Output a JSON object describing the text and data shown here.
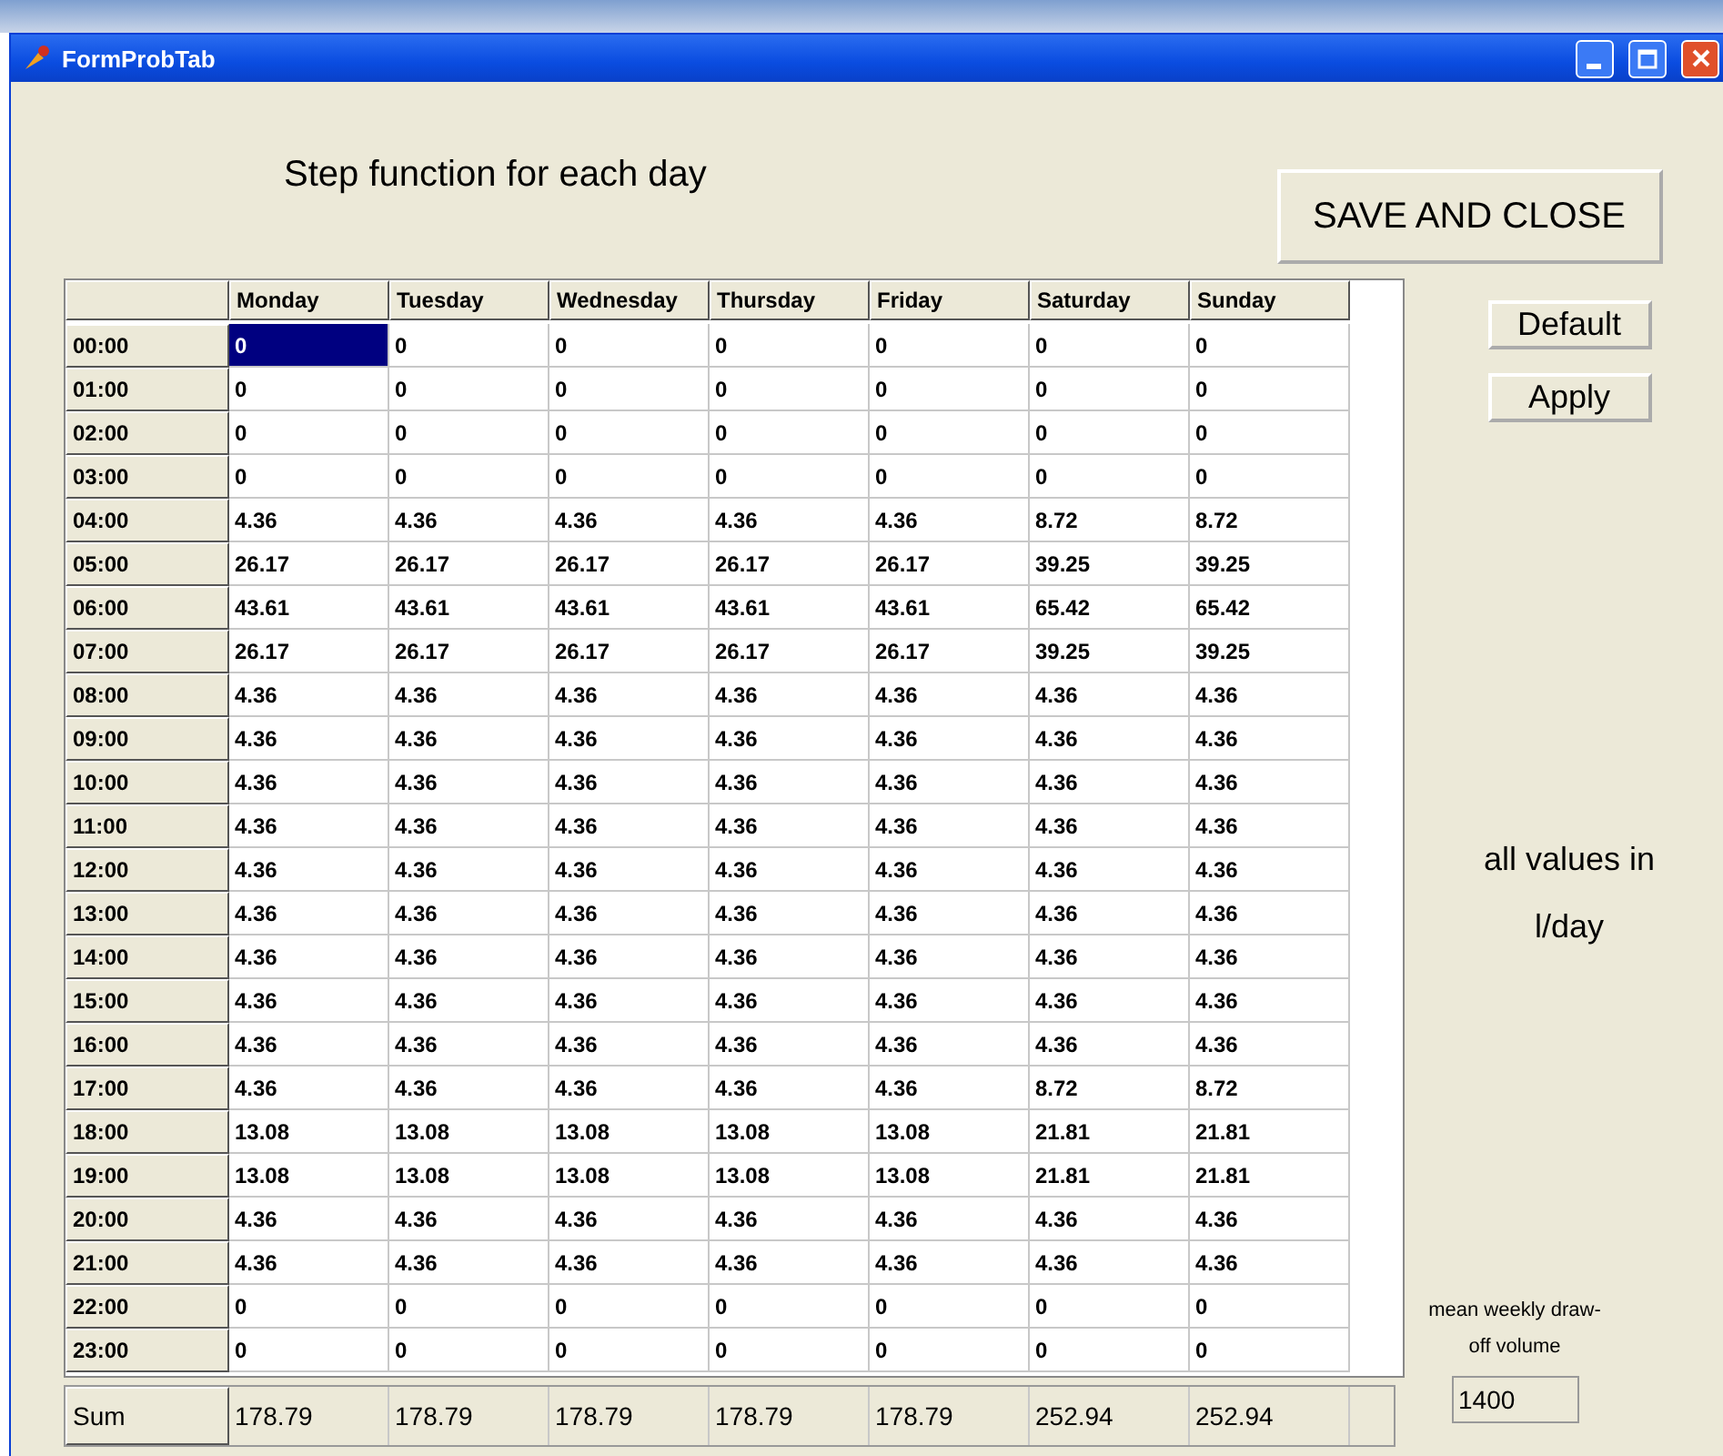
{
  "window": {
    "title": "FormProbTab"
  },
  "heading": "Step function for each day",
  "save_button": "SAVE AND CLOSE",
  "buttons": [
    "Default",
    "Apply"
  ],
  "note": [
    "all values in",
    "l/day"
  ],
  "table": {
    "columns": [
      "Monday",
      "Tuesday",
      "Wednesday",
      "Thursday",
      "Friday",
      "Saturday",
      "Sunday"
    ],
    "rows": [
      {
        "time": "00:00",
        "cells": [
          {
            "v": "0",
            "selected": true
          },
          {
            "v": "0",
            "selected": false
          },
          {
            "v": "0",
            "selected": false
          },
          {
            "v": "0",
            "selected": false
          },
          {
            "v": "0",
            "selected": false
          },
          {
            "v": "0",
            "selected": false
          },
          {
            "v": "0",
            "selected": false
          }
        ]
      },
      {
        "time": "01:00",
        "cells": [
          {
            "v": "0",
            "selected": false
          },
          {
            "v": "0",
            "selected": false
          },
          {
            "v": "0",
            "selected": false
          },
          {
            "v": "0",
            "selected": false
          },
          {
            "v": "0",
            "selected": false
          },
          {
            "v": "0",
            "selected": false
          },
          {
            "v": "0",
            "selected": false
          }
        ]
      },
      {
        "time": "02:00",
        "cells": [
          {
            "v": "0",
            "selected": false
          },
          {
            "v": "0",
            "selected": false
          },
          {
            "v": "0",
            "selected": false
          },
          {
            "v": "0",
            "selected": false
          },
          {
            "v": "0",
            "selected": false
          },
          {
            "v": "0",
            "selected": false
          },
          {
            "v": "0",
            "selected": false
          }
        ]
      },
      {
        "time": "03:00",
        "cells": [
          {
            "v": "0",
            "selected": false
          },
          {
            "v": "0",
            "selected": false
          },
          {
            "v": "0",
            "selected": false
          },
          {
            "v": "0",
            "selected": false
          },
          {
            "v": "0",
            "selected": false
          },
          {
            "v": "0",
            "selected": false
          },
          {
            "v": "0",
            "selected": false
          }
        ]
      },
      {
        "time": "04:00",
        "cells": [
          {
            "v": "4.36",
            "selected": false
          },
          {
            "v": "4.36",
            "selected": false
          },
          {
            "v": "4.36",
            "selected": false
          },
          {
            "v": "4.36",
            "selected": false
          },
          {
            "v": "4.36",
            "selected": false
          },
          {
            "v": "8.72",
            "selected": false
          },
          {
            "v": "8.72",
            "selected": false
          }
        ]
      },
      {
        "time": "05:00",
        "cells": [
          {
            "v": "26.17",
            "selected": false
          },
          {
            "v": "26.17",
            "selected": false
          },
          {
            "v": "26.17",
            "selected": false
          },
          {
            "v": "26.17",
            "selected": false
          },
          {
            "v": "26.17",
            "selected": false
          },
          {
            "v": "39.25",
            "selected": false
          },
          {
            "v": "39.25",
            "selected": false
          }
        ]
      },
      {
        "time": "06:00",
        "cells": [
          {
            "v": "43.61",
            "selected": false
          },
          {
            "v": "43.61",
            "selected": false
          },
          {
            "v": "43.61",
            "selected": false
          },
          {
            "v": "43.61",
            "selected": false
          },
          {
            "v": "43.61",
            "selected": false
          },
          {
            "v": "65.42",
            "selected": false
          },
          {
            "v": "65.42",
            "selected": false
          }
        ]
      },
      {
        "time": "07:00",
        "cells": [
          {
            "v": "26.17",
            "selected": false
          },
          {
            "v": "26.17",
            "selected": false
          },
          {
            "v": "26.17",
            "selected": false
          },
          {
            "v": "26.17",
            "selected": false
          },
          {
            "v": "26.17",
            "selected": false
          },
          {
            "v": "39.25",
            "selected": false
          },
          {
            "v": "39.25",
            "selected": false
          }
        ]
      },
      {
        "time": "08:00",
        "cells": [
          {
            "v": "4.36",
            "selected": false
          },
          {
            "v": "4.36",
            "selected": false
          },
          {
            "v": "4.36",
            "selected": false
          },
          {
            "v": "4.36",
            "selected": false
          },
          {
            "v": "4.36",
            "selected": false
          },
          {
            "v": "4.36",
            "selected": false
          },
          {
            "v": "4.36",
            "selected": false
          }
        ]
      },
      {
        "time": "09:00",
        "cells": [
          {
            "v": "4.36",
            "selected": false
          },
          {
            "v": "4.36",
            "selected": false
          },
          {
            "v": "4.36",
            "selected": false
          },
          {
            "v": "4.36",
            "selected": false
          },
          {
            "v": "4.36",
            "selected": false
          },
          {
            "v": "4.36",
            "selected": false
          },
          {
            "v": "4.36",
            "selected": false
          }
        ]
      },
      {
        "time": "10:00",
        "cells": [
          {
            "v": "4.36",
            "selected": false
          },
          {
            "v": "4.36",
            "selected": false
          },
          {
            "v": "4.36",
            "selected": false
          },
          {
            "v": "4.36",
            "selected": false
          },
          {
            "v": "4.36",
            "selected": false
          },
          {
            "v": "4.36",
            "selected": false
          },
          {
            "v": "4.36",
            "selected": false
          }
        ]
      },
      {
        "time": "11:00",
        "cells": [
          {
            "v": "4.36",
            "selected": false
          },
          {
            "v": "4.36",
            "selected": false
          },
          {
            "v": "4.36",
            "selected": false
          },
          {
            "v": "4.36",
            "selected": false
          },
          {
            "v": "4.36",
            "selected": false
          },
          {
            "v": "4.36",
            "selected": false
          },
          {
            "v": "4.36",
            "selected": false
          }
        ]
      },
      {
        "time": "12:00",
        "cells": [
          {
            "v": "4.36",
            "selected": false
          },
          {
            "v": "4.36",
            "selected": false
          },
          {
            "v": "4.36",
            "selected": false
          },
          {
            "v": "4.36",
            "selected": false
          },
          {
            "v": "4.36",
            "selected": false
          },
          {
            "v": "4.36",
            "selected": false
          },
          {
            "v": "4.36",
            "selected": false
          }
        ]
      },
      {
        "time": "13:00",
        "cells": [
          {
            "v": "4.36",
            "selected": false
          },
          {
            "v": "4.36",
            "selected": false
          },
          {
            "v": "4.36",
            "selected": false
          },
          {
            "v": "4.36",
            "selected": false
          },
          {
            "v": "4.36",
            "selected": false
          },
          {
            "v": "4.36",
            "selected": false
          },
          {
            "v": "4.36",
            "selected": false
          }
        ]
      },
      {
        "time": "14:00",
        "cells": [
          {
            "v": "4.36",
            "selected": false
          },
          {
            "v": "4.36",
            "selected": false
          },
          {
            "v": "4.36",
            "selected": false
          },
          {
            "v": "4.36",
            "selected": false
          },
          {
            "v": "4.36",
            "selected": false
          },
          {
            "v": "4.36",
            "selected": false
          },
          {
            "v": "4.36",
            "selected": false
          }
        ]
      },
      {
        "time": "15:00",
        "cells": [
          {
            "v": "4.36",
            "selected": false
          },
          {
            "v": "4.36",
            "selected": false
          },
          {
            "v": "4.36",
            "selected": false
          },
          {
            "v": "4.36",
            "selected": false
          },
          {
            "v": "4.36",
            "selected": false
          },
          {
            "v": "4.36",
            "selected": false
          },
          {
            "v": "4.36",
            "selected": false
          }
        ]
      },
      {
        "time": "16:00",
        "cells": [
          {
            "v": "4.36",
            "selected": false
          },
          {
            "v": "4.36",
            "selected": false
          },
          {
            "v": "4.36",
            "selected": false
          },
          {
            "v": "4.36",
            "selected": false
          },
          {
            "v": "4.36",
            "selected": false
          },
          {
            "v": "4.36",
            "selected": false
          },
          {
            "v": "4.36",
            "selected": false
          }
        ]
      },
      {
        "time": "17:00",
        "cells": [
          {
            "v": "4.36",
            "selected": false
          },
          {
            "v": "4.36",
            "selected": false
          },
          {
            "v": "4.36",
            "selected": false
          },
          {
            "v": "4.36",
            "selected": false
          },
          {
            "v": "4.36",
            "selected": false
          },
          {
            "v": "8.72",
            "selected": false
          },
          {
            "v": "8.72",
            "selected": false
          }
        ]
      },
      {
        "time": "18:00",
        "cells": [
          {
            "v": "13.08",
            "selected": false
          },
          {
            "v": "13.08",
            "selected": false
          },
          {
            "v": "13.08",
            "selected": false
          },
          {
            "v": "13.08",
            "selected": false
          },
          {
            "v": "13.08",
            "selected": false
          },
          {
            "v": "21.81",
            "selected": false
          },
          {
            "v": "21.81",
            "selected": false
          }
        ]
      },
      {
        "time": "19:00",
        "cells": [
          {
            "v": "13.08",
            "selected": false
          },
          {
            "v": "13.08",
            "selected": false
          },
          {
            "v": "13.08",
            "selected": false
          },
          {
            "v": "13.08",
            "selected": false
          },
          {
            "v": "13.08",
            "selected": false
          },
          {
            "v": "21.81",
            "selected": false
          },
          {
            "v": "21.81",
            "selected": false
          }
        ]
      },
      {
        "time": "20:00",
        "cells": [
          {
            "v": "4.36",
            "selected": false
          },
          {
            "v": "4.36",
            "selected": false
          },
          {
            "v": "4.36",
            "selected": false
          },
          {
            "v": "4.36",
            "selected": false
          },
          {
            "v": "4.36",
            "selected": false
          },
          {
            "v": "4.36",
            "selected": false
          },
          {
            "v": "4.36",
            "selected": false
          }
        ]
      },
      {
        "time": "21:00",
        "cells": [
          {
            "v": "4.36",
            "selected": false
          },
          {
            "v": "4.36",
            "selected": false
          },
          {
            "v": "4.36",
            "selected": false
          },
          {
            "v": "4.36",
            "selected": false
          },
          {
            "v": "4.36",
            "selected": false
          },
          {
            "v": "4.36",
            "selected": false
          },
          {
            "v": "4.36",
            "selected": false
          }
        ]
      },
      {
        "time": "22:00",
        "cells": [
          {
            "v": "0",
            "selected": false
          },
          {
            "v": "0",
            "selected": false
          },
          {
            "v": "0",
            "selected": false
          },
          {
            "v": "0",
            "selected": false
          },
          {
            "v": "0",
            "selected": false
          },
          {
            "v": "0",
            "selected": false
          },
          {
            "v": "0",
            "selected": false
          }
        ]
      },
      {
        "time": "23:00",
        "cells": [
          {
            "v": "0",
            "selected": false
          },
          {
            "v": "0",
            "selected": false
          },
          {
            "v": "0",
            "selected": false
          },
          {
            "v": "0",
            "selected": false
          },
          {
            "v": "0",
            "selected": false
          },
          {
            "v": "0",
            "selected": false
          },
          {
            "v": "0",
            "selected": false
          }
        ]
      }
    ],
    "sum": {
      "label": "Sum",
      "values": [
        "178.79",
        "178.79",
        "178.79",
        "178.79",
        "178.79",
        "252.94",
        "252.94"
      ]
    }
  },
  "volume": {
    "label": "mean weekly draw-off volume",
    "value": "1400"
  }
}
